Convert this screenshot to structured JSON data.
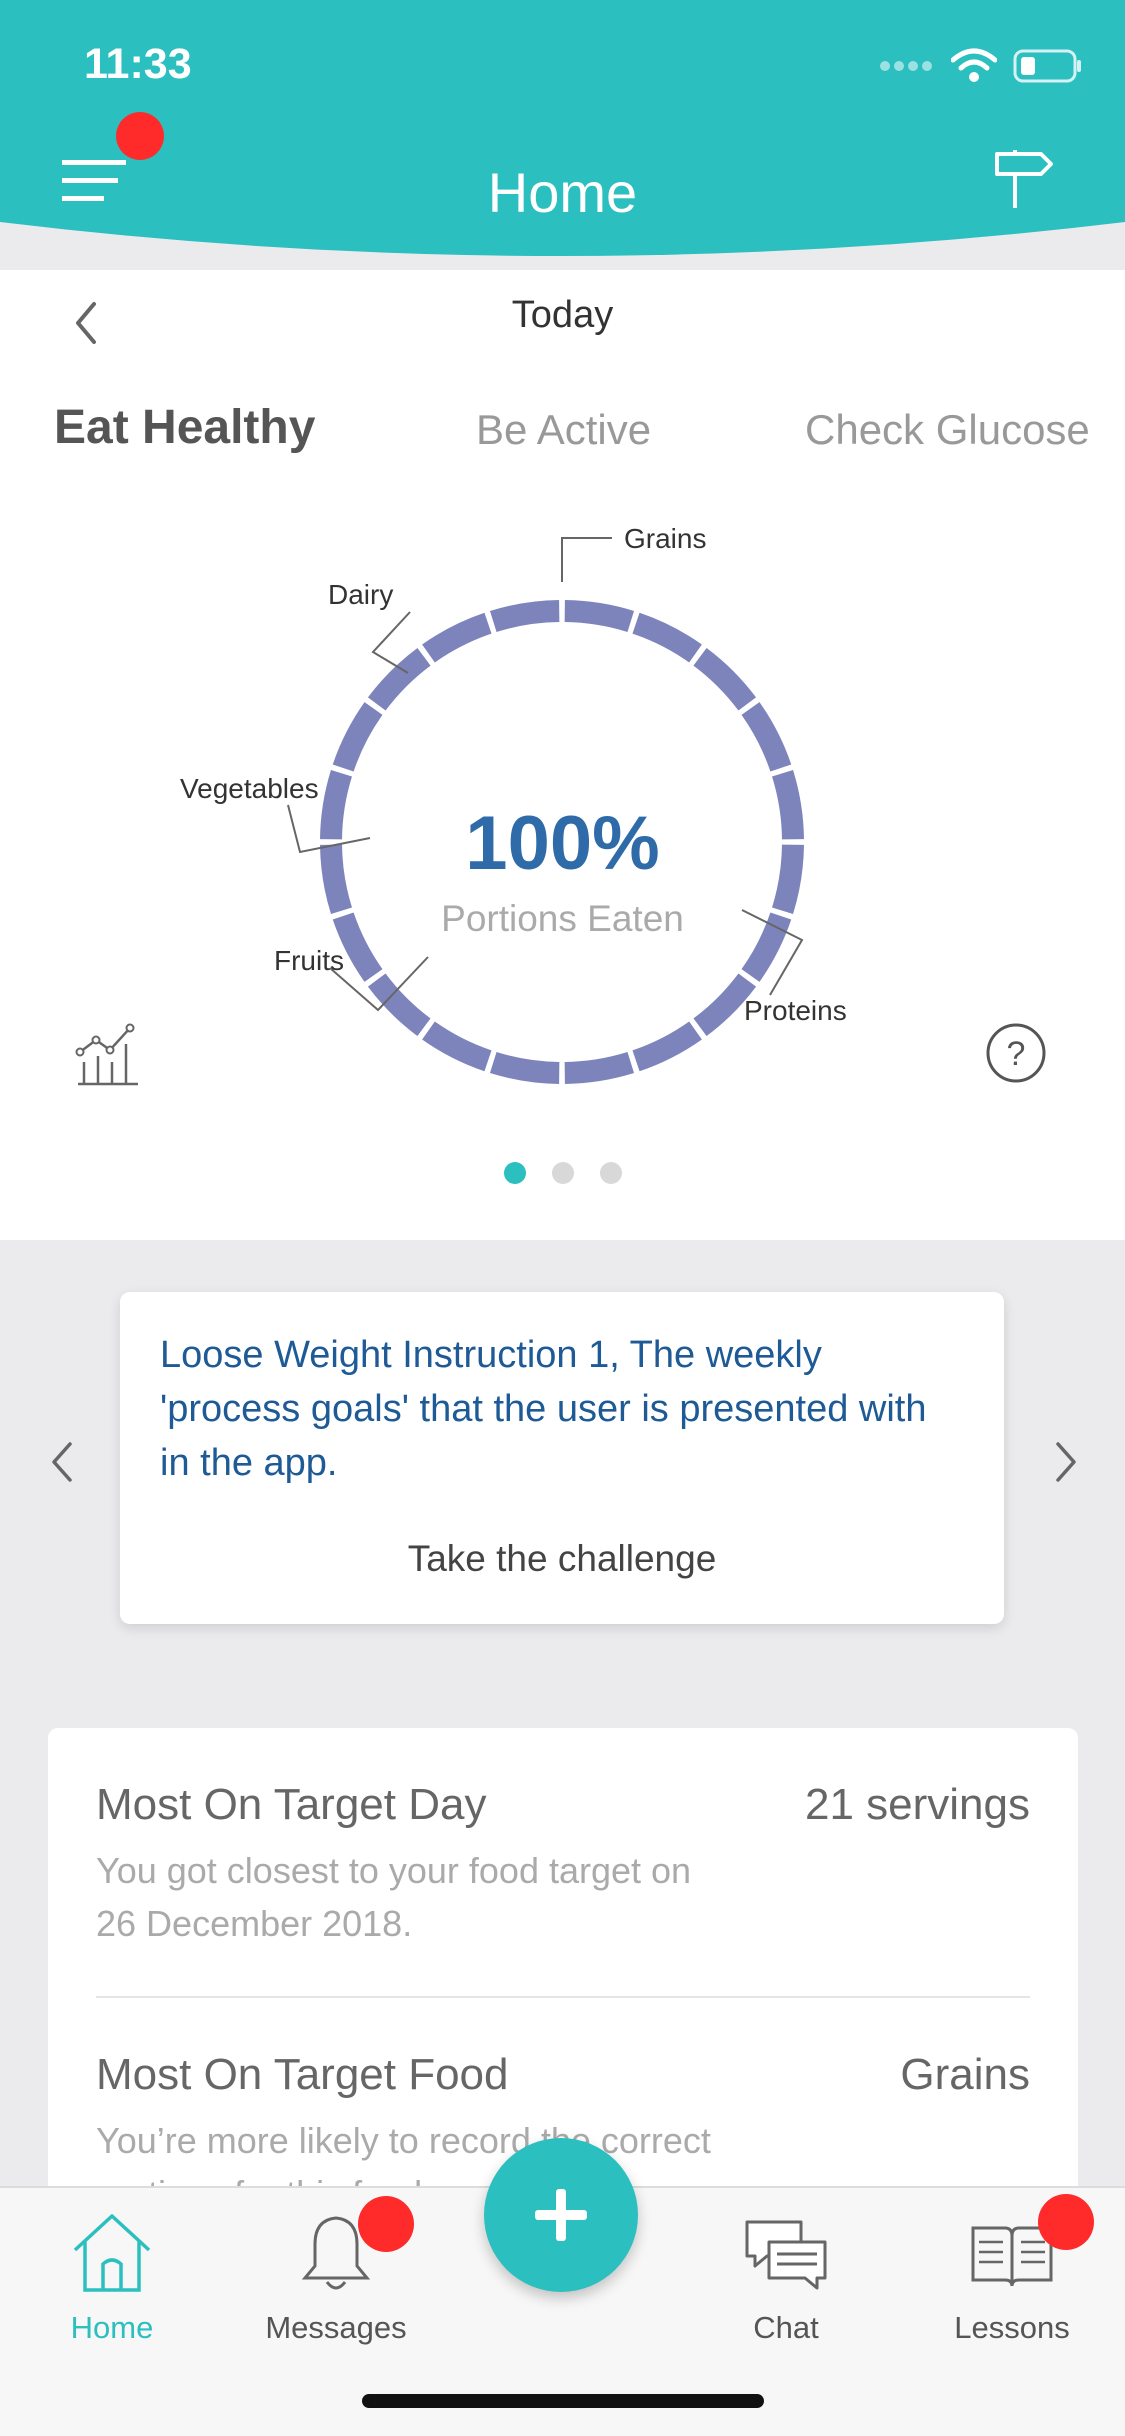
{
  "status_bar": {
    "time": "11:33"
  },
  "header": {
    "title": "Home"
  },
  "date_nav": {
    "label": "Today"
  },
  "goal_tabs": [
    {
      "label": "Eat Healthy",
      "active": true
    },
    {
      "label": "Be Active",
      "active": false
    },
    {
      "label": "Check Glucose",
      "active": false
    }
  ],
  "portions": {
    "percent": "100%",
    "caption": "Portions Eaten",
    "labels": {
      "grains": "Grains",
      "dairy": "Dairy",
      "vegetables": "Vegetables",
      "fruits": "Fruits",
      "proteins": "Proteins"
    }
  },
  "pager": {
    "count": 3,
    "active_index": 0
  },
  "challenge": {
    "text": "Loose Weight Instruction 1, The weekly 'process goals' that the user is presented with in the app.",
    "action": "Take the challenge"
  },
  "stats": [
    {
      "title": "Most On Target Day",
      "value": "21 servings",
      "description": "You got closest to your food target on 26 December 2018."
    },
    {
      "title": "Most On Target Food",
      "value": "Grains",
      "description": "You’re more likely to record the correct portions for this food."
    }
  ],
  "tab_bar": {
    "home": "Home",
    "messages": "Messages",
    "chat": "Chat",
    "lessons": "Lessons"
  },
  "colors": {
    "accent": "#2bbfc0",
    "ring": "#7c84bb",
    "badge": "#ff2a2a",
    "challenge_text": "#1e5a96",
    "percent_text": "#2e6ba8"
  },
  "icons": {
    "menu": "hamburger-menu-icon",
    "signpost": "signpost-icon",
    "back": "chevron-left-icon",
    "chart": "line-chart-icon",
    "help": "question-circle-icon",
    "add": "plus-icon",
    "home": "house-icon",
    "messages": "bell-icon",
    "chat": "chat-bubbles-icon",
    "lessons": "open-book-icon"
  }
}
